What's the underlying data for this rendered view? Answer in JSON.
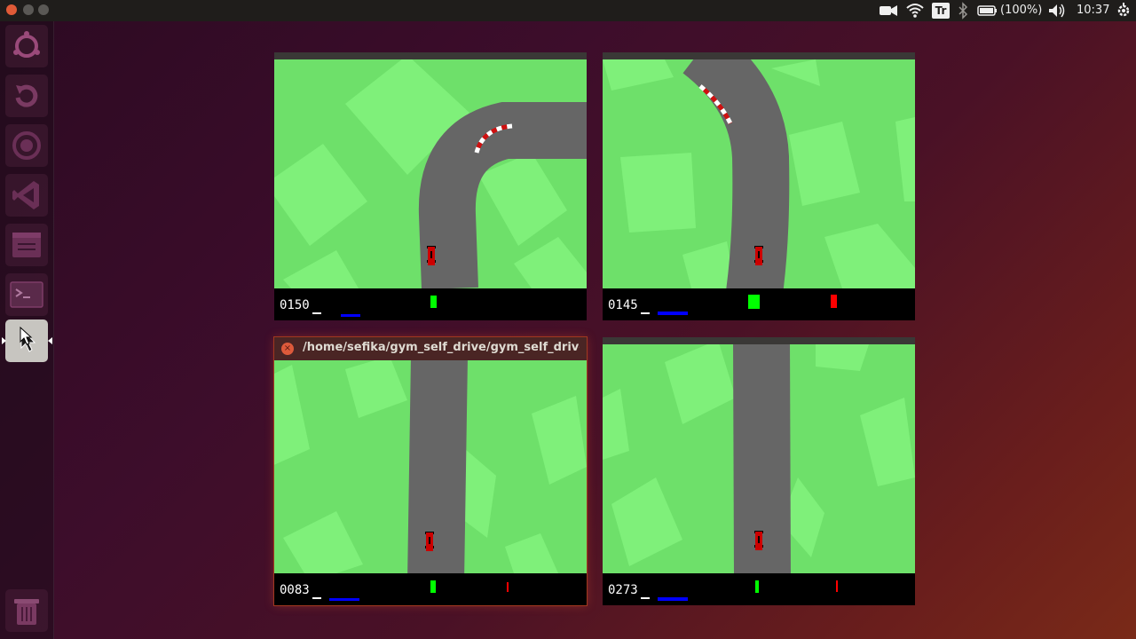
{
  "top_panel": {
    "battery_label": "(100%)",
    "clock": "10:37",
    "icons": [
      "camera-icon",
      "wifi-icon",
      "keyboard-layout-icon",
      "bluetooth-icon",
      "battery-icon",
      "volume-icon",
      "settings-gear-icon"
    ],
    "keyboard_layout": "Tr"
  },
  "launcher": {
    "items": [
      "ubuntu-dash-icon",
      "software-updater-icon",
      "obs-record-icon",
      "vscode-icon",
      "files-window-icon",
      "terminal-icon",
      "pointer-app-icon",
      "trash-icon"
    ]
  },
  "windows": [
    {
      "score": "0150",
      "title": ""
    },
    {
      "score": "0145",
      "title": ""
    },
    {
      "score": "0083",
      "title": "/home/sefika/gym_self_drive/gym_self_drive/"
    },
    {
      "score": "0273",
      "title": ""
    }
  ],
  "colors": {
    "grass": "#6ee06a",
    "grass_light": "#7ff07a",
    "road": "#666666",
    "kerb_red": "#d01010",
    "car_red": "#cc0000",
    "hud_green": "#00ff00",
    "hud_blue": "#0000ff",
    "hud_red": "#ff0000"
  }
}
